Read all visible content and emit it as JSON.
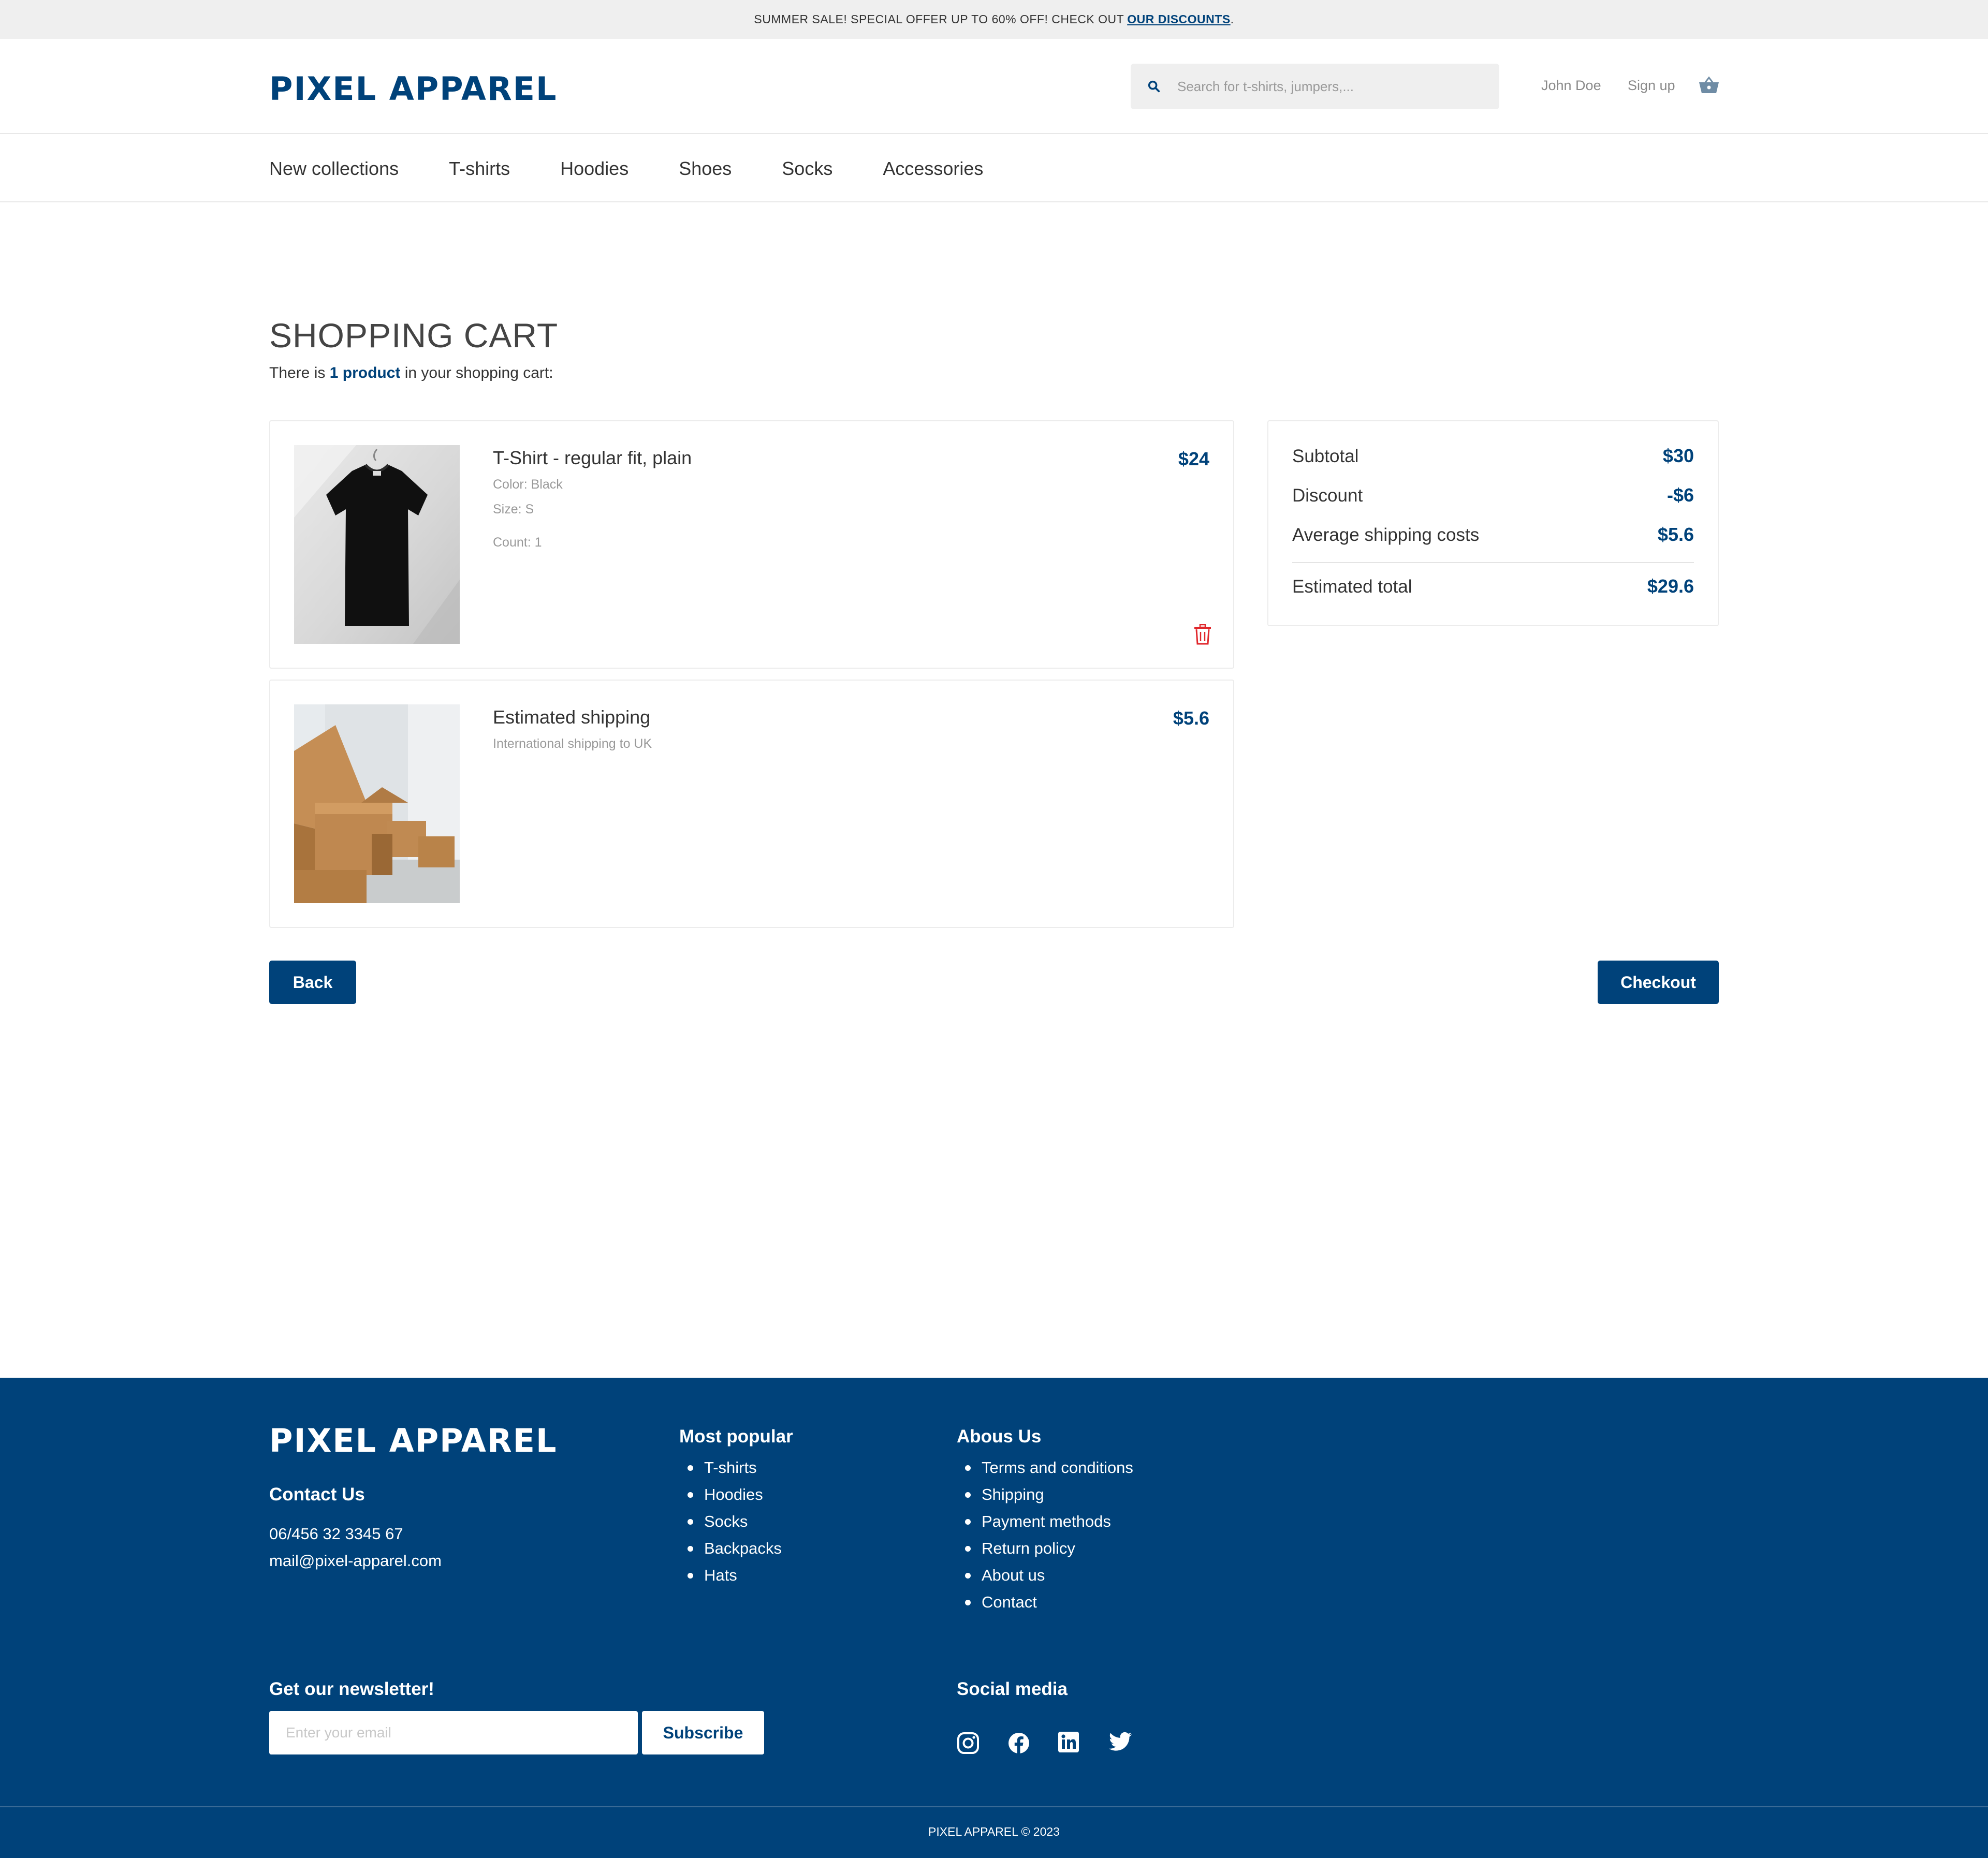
{
  "announcement": {
    "text": "SUMMER SALE! SPECIAL OFFER UP TO 60% OFF! CHECK OUT",
    "link": "OUR DISCOUNTS",
    "suffix": "."
  },
  "header": {
    "logo": "PIXEL APPAREL",
    "search_placeholder": "Search for t-shirts, jumpers,...",
    "user_link": "John Doe",
    "signup_link": "Sign up"
  },
  "nav": {
    "items": [
      "New collections",
      "T-shirts",
      "Hoodies",
      "Shoes",
      "Socks",
      "Accessories"
    ]
  },
  "cart": {
    "title": "SHOPPING CART",
    "subtitle_prefix": "There is",
    "subtitle_count": "1 product",
    "subtitle_suffix": "in your shopping cart:",
    "items": [
      {
        "name": "T-Shirt - regular fit, plain",
        "color": "Color: Black",
        "size": "Size: S",
        "count": "Count: 1",
        "price": "$24"
      }
    ],
    "shipping": {
      "name": "Estimated shipping",
      "description": "International shipping to UK",
      "price": "$5.6"
    },
    "summary": {
      "subtotal_label": "Subtotal",
      "subtotal_value": "$30",
      "discount_label": "Discount",
      "discount_value": "-$6",
      "shipping_label": "Average shipping costs",
      "shipping_value": "$5.6",
      "total_label": "Estimated total",
      "total_value": "$29.6"
    },
    "back_label": "Back",
    "checkout_label": "Checkout"
  },
  "footer": {
    "logo": "PIXEL APPAREL",
    "contact_heading": "Contact Us",
    "phone": "06/456 32 3345 67",
    "email": "mail@pixel-apparel.com",
    "popular_heading": "Most popular",
    "popular_items": [
      "T-shirts",
      "Hoodies",
      "Socks",
      "Backpacks",
      "Hats"
    ],
    "about_heading": "Abous Us",
    "about_items": [
      "Terms and conditions",
      "Shipping",
      "Payment methods",
      "Return policy",
      "About us",
      "Contact"
    ],
    "newsletter_heading": "Get our newsletter!",
    "newsletter_placeholder": "Enter your email",
    "subscribe_label": "Subscribe",
    "social_heading": "Social media",
    "social_icons": [
      "instagram-icon",
      "facebook-icon",
      "linkedin-icon",
      "twitter-icon"
    ],
    "copyright": "PIXEL APPAREL © 2023"
  },
  "colors": {
    "brand": "#00427a",
    "danger": "#e0262b",
    "announce_bg": "#efefef"
  }
}
